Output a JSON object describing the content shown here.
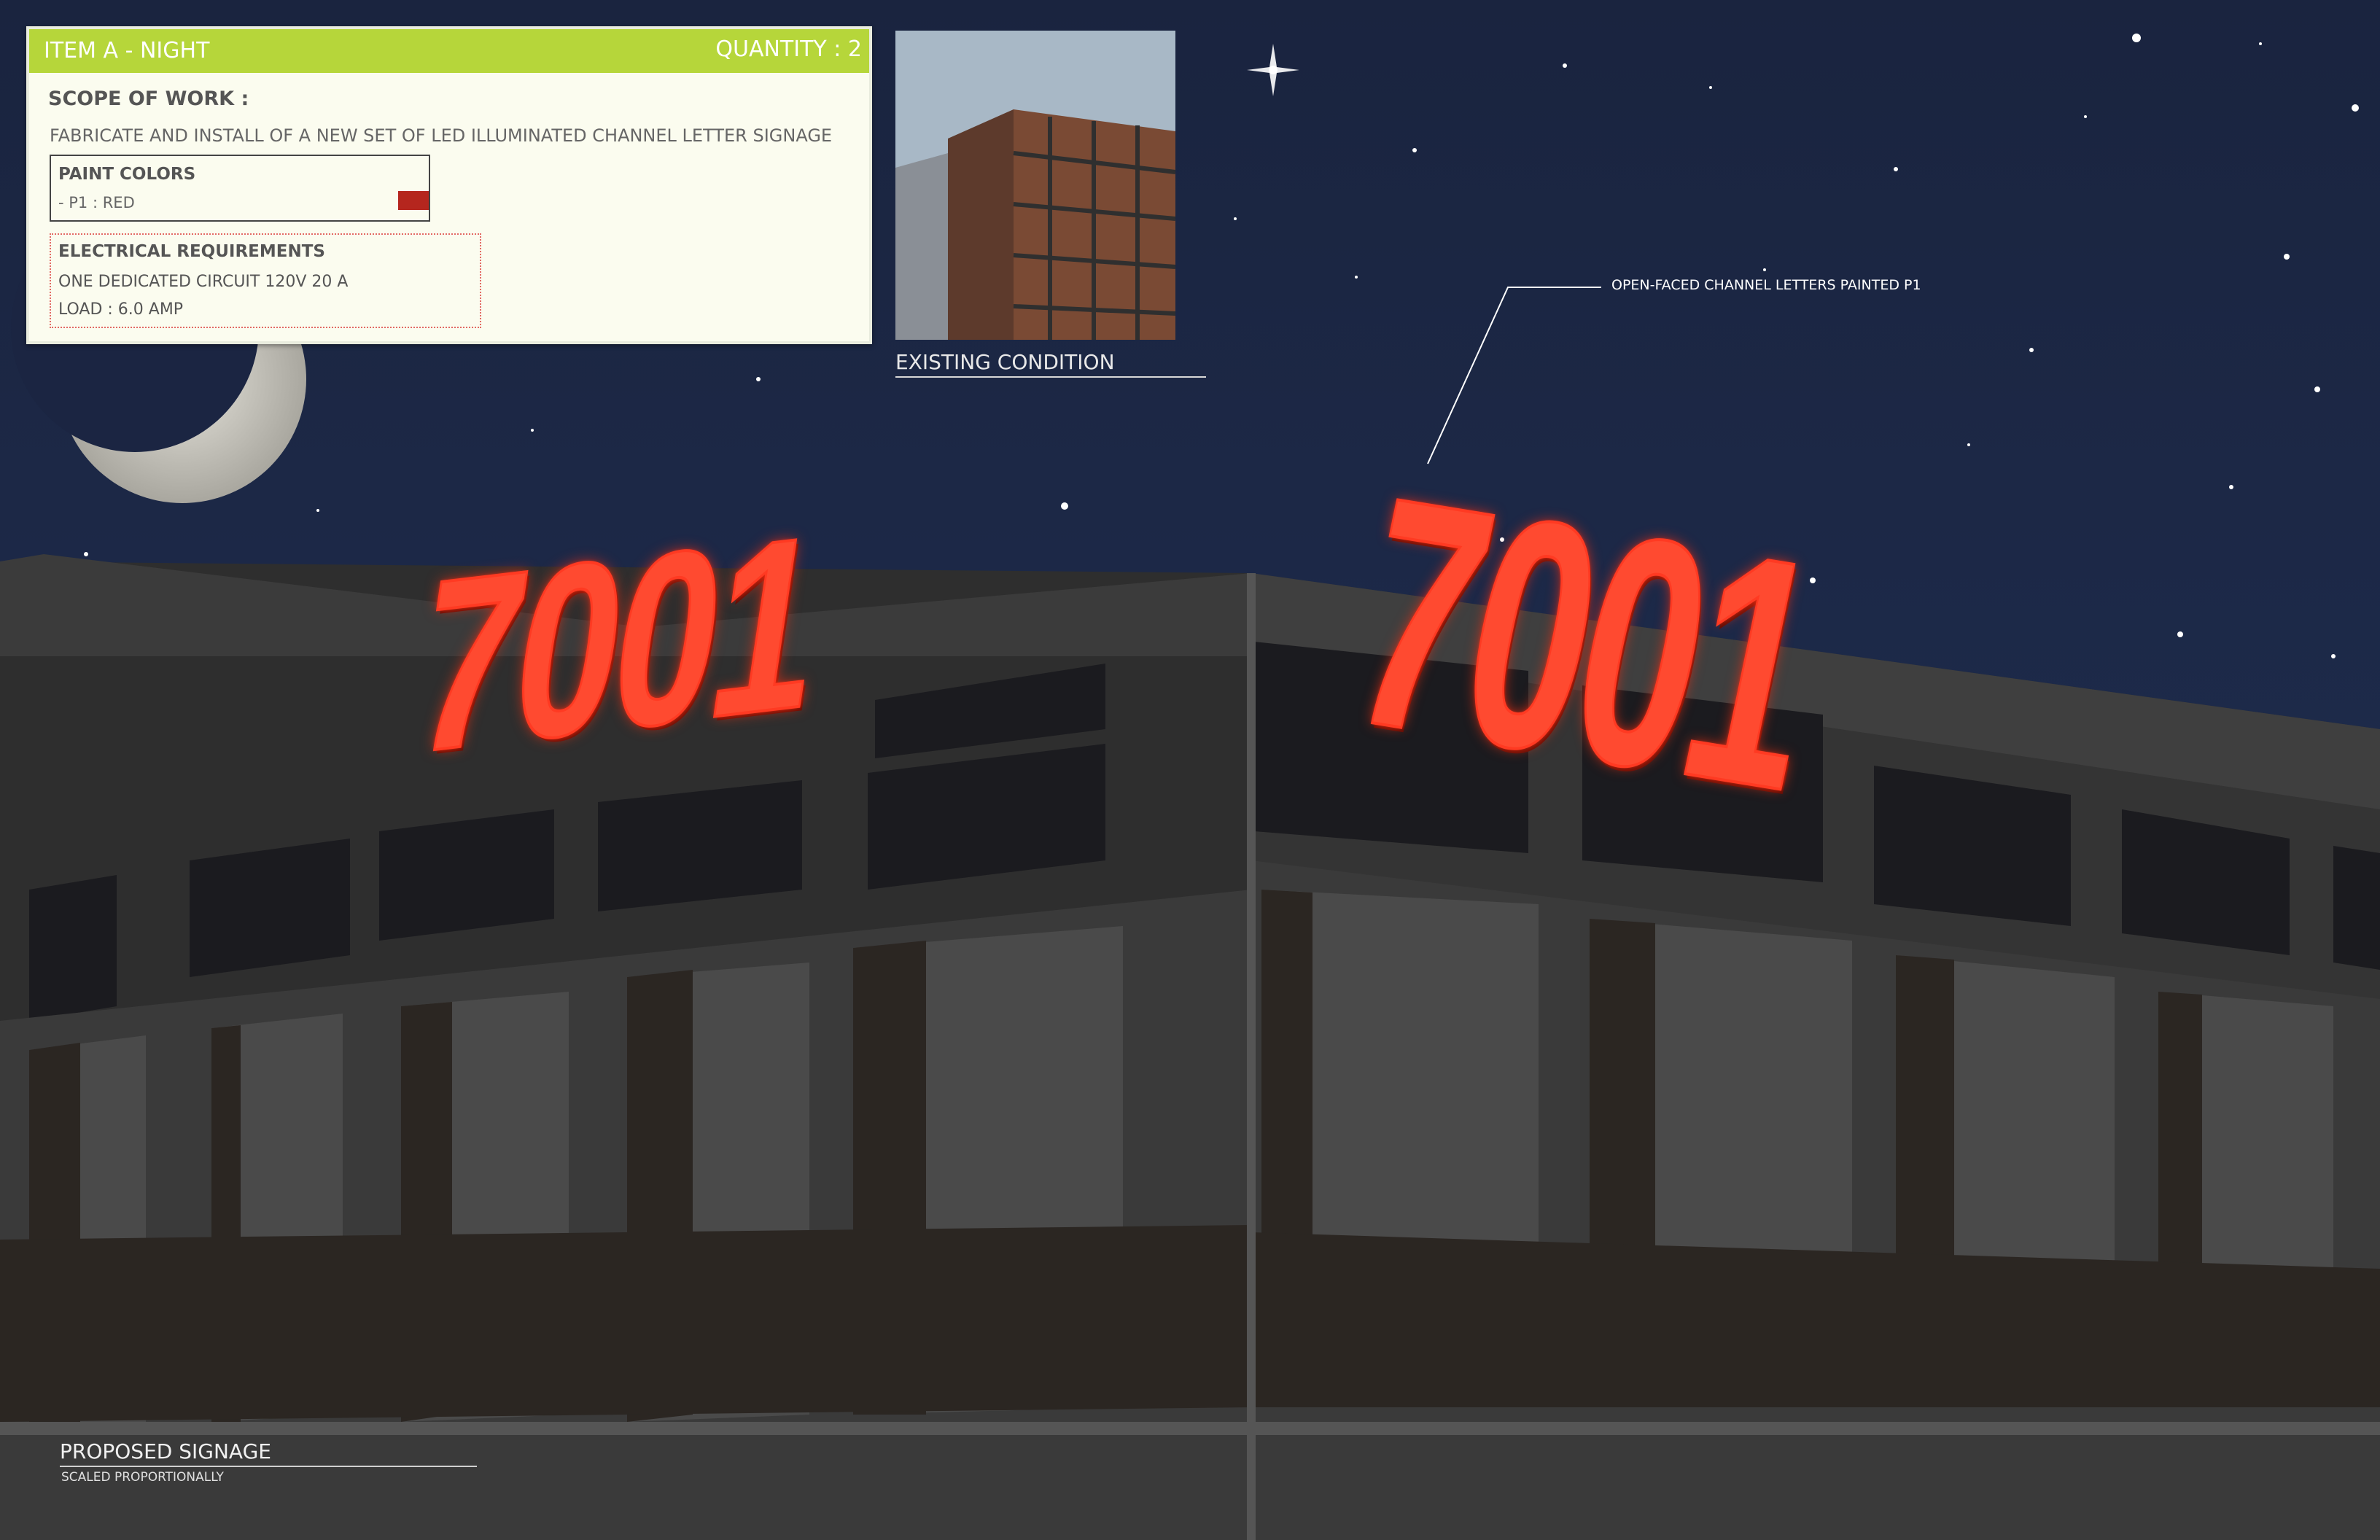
{
  "card": {
    "title": "ITEM A - NIGHT",
    "quantity": "QUANTITY : 2",
    "scope_label": "SCOPE OF WORK :",
    "scope_text": "FABRICATE AND INSTALL OF A NEW SET OF LED ILLUMINATED CHANNEL LETTER SIGNAGE",
    "paint_header": "PAINT COLORS",
    "paint_item": "- P1 : RED",
    "paint_swatch_color": "#b5261e",
    "electrical_header": "ELECTRICAL REQUIREMENTS",
    "electrical_line1": "ONE DEDICATED CIRCUIT 120V 20 A",
    "electrical_line2": "LOAD : 6.0 AMP",
    "header_color": "#b6d63a"
  },
  "existing": {
    "label": "EXISTING CONDITION"
  },
  "callout": {
    "text": "OPEN-FACED CHANNEL LETTERS PAINTED P1"
  },
  "signs": {
    "left_text": "7001",
    "right_text": "7001",
    "color": "#ff3a22"
  },
  "proposed": {
    "label": "PROPOSED SIGNAGE",
    "sub": "SCALED PROPORTIONALLY"
  }
}
